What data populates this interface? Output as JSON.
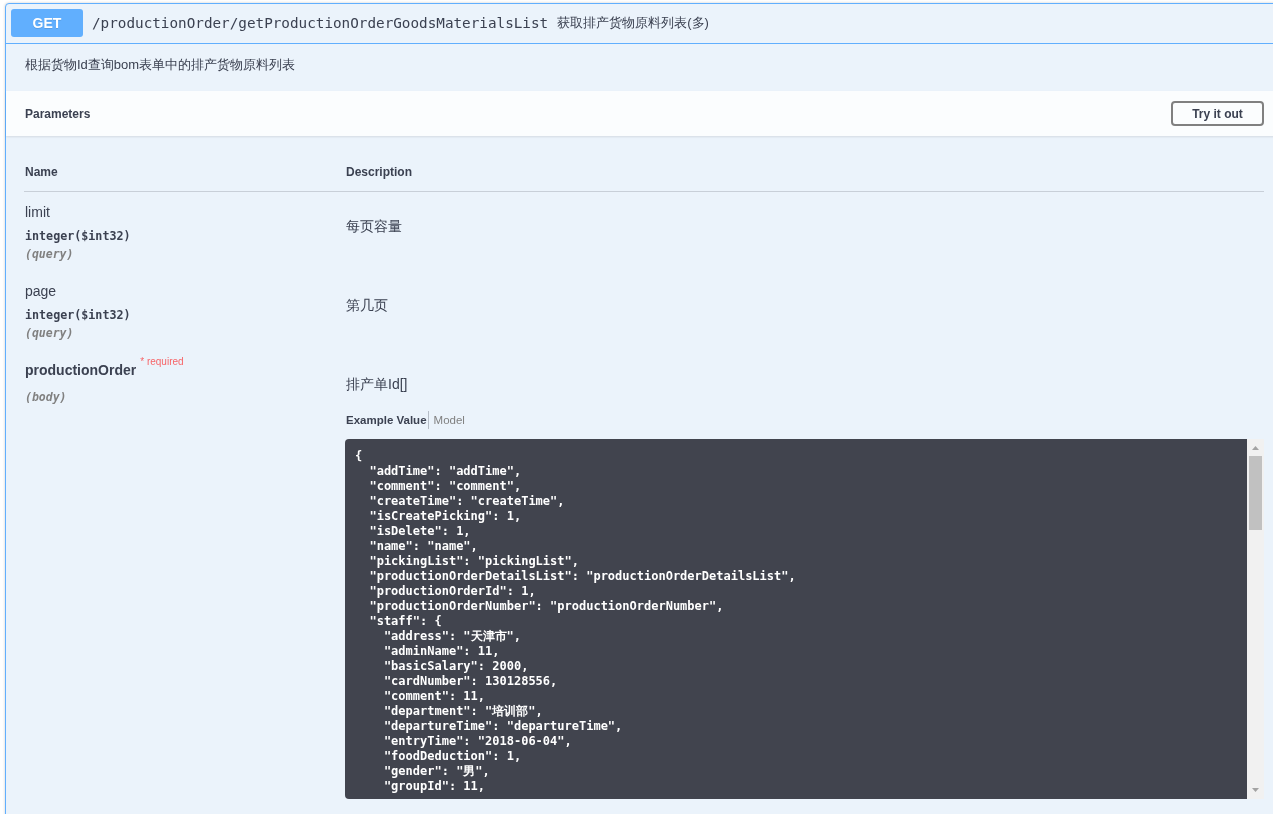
{
  "operation": {
    "method": "GET",
    "path": "/productionOrder/getProductionOrderGoodsMaterialsList",
    "summary": "获取排产货物原料列表(多)",
    "description": "根据货物Id查询bom表单中的排产货物原料列表"
  },
  "parameters": {
    "title": "Parameters",
    "try_button": "Try it out",
    "columns": [
      "Name",
      "Description"
    ],
    "rows": [
      {
        "name": "limit",
        "required": false,
        "type": "integer($int32)",
        "location": "(query)",
        "description": "每页容量"
      },
      {
        "name": "page",
        "required": false,
        "type": "integer($int32)",
        "location": "(query)",
        "description": "第几页"
      },
      {
        "name": "productionOrder",
        "required": true,
        "required_label": "* required",
        "location": "(body)",
        "description": "排产单Id[]",
        "example": {
          "tabs": [
            {
              "label": "Example Value",
              "selected": true
            },
            {
              "label": "Model",
              "selected": false
            }
          ],
          "lines": [
            "{",
            "  \"addTime\": \"addTime\",",
            "  \"comment\": \"comment\",",
            "  \"createTime\": \"createTime\",",
            "  \"isCreatePicking\": 1,",
            "  \"isDelete\": 1,",
            "  \"name\": \"name\",",
            "  \"pickingList\": \"pickingList\",",
            "  \"productionOrderDetailsList\": \"productionOrderDetailsList\",",
            "  \"productionOrderId\": 1,",
            "  \"productionOrderNumber\": \"productionOrderNumber\",",
            "  \"staff\": {",
            "    \"address\": \"天津市\",",
            "    \"adminName\": 11,",
            "    \"basicSalary\": 2000,",
            "    \"cardNumber\": 130128556,",
            "    \"comment\": 11,",
            "    \"department\": \"培训部\",",
            "    \"departureTime\": \"departureTime\",",
            "    \"entryTime\": \"2018-06-04\",",
            "    \"foodDeduction\": 1,",
            "    \"gender\": \"男\",",
            "    \"groupId\": 11,"
          ]
        }
      }
    ]
  }
}
